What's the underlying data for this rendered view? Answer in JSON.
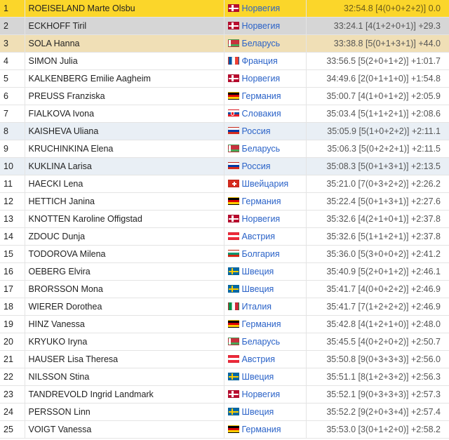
{
  "flag_colors": {
    "nor": "#ba0c2f",
    "blr": "#c8313e",
    "fra": "#0055a4",
    "ger": "#dd0000",
    "svk": "#0b4ea2",
    "rus": "#0039a6",
    "sui": "#d52b1e",
    "aut": "#ed2939",
    "bul": "#00966e",
    "swe": "#006aa7",
    "ita": "#009246"
  },
  "highlight_colors": {
    "gold": "#fbd62a",
    "silver": "#d6d6d6",
    "bronze": "#f0dfb6",
    "hl": "#e9eff5"
  },
  "results": [
    {
      "rank": "1",
      "name": "ROEISELAND Marte Olsbu",
      "flag": "flag-nor",
      "country": "Норвегия",
      "result": "32:54.8 [4(0+0+2+2)] 0.0",
      "style": "gold"
    },
    {
      "rank": "2",
      "name": "ECKHOFF Tiril",
      "flag": "flag-nor",
      "country": "Норвегия",
      "result": "33:24.1 [4(1+2+0+1)] +29.3",
      "style": "silver"
    },
    {
      "rank": "3",
      "name": "SOLA Hanna",
      "flag": "flag-blr",
      "country": "Беларусь",
      "result": "33:38.8 [5(0+1+3+1)] +44.0",
      "style": "bronze"
    },
    {
      "rank": "4",
      "name": "SIMON Julia",
      "flag": "flag-fra",
      "country": "Франция",
      "result": "33:56.5 [5(2+0+1+2)] +1:01.7",
      "style": ""
    },
    {
      "rank": "5",
      "name": "KALKENBERG Emilie Aagheim",
      "flag": "flag-nor",
      "country": "Норвегия",
      "result": "34:49.6 [2(0+1+1+0)] +1:54.8",
      "style": ""
    },
    {
      "rank": "6",
      "name": "PREUSS Franziska",
      "flag": "flag-ger",
      "country": "Германия",
      "result": "35:00.7 [4(1+0+1+2)] +2:05.9",
      "style": ""
    },
    {
      "rank": "7",
      "name": "FIALKOVA Ivona",
      "flag": "flag-svk",
      "country": "Словакия",
      "result": "35:03.4 [5(1+1+2+1)] +2:08.6",
      "style": ""
    },
    {
      "rank": "8",
      "name": "KAISHEVA Uliana",
      "flag": "flag-rus",
      "country": "Россия",
      "result": "35:05.9 [5(1+0+2+2)] +2:11.1",
      "style": "hl"
    },
    {
      "rank": "9",
      "name": "KRUCHINKINA Elena",
      "flag": "flag-blr",
      "country": "Беларусь",
      "result": "35:06.3 [5(0+2+2+1)] +2:11.5",
      "style": ""
    },
    {
      "rank": "10",
      "name": "KUKLINA Larisa",
      "flag": "flag-rus",
      "country": "Россия",
      "result": "35:08.3 [5(0+1+3+1)] +2:13.5",
      "style": "hl"
    },
    {
      "rank": "11",
      "name": "HAECKI Lena",
      "flag": "flag-sui",
      "country": "Швейцария",
      "result": "35:21.0 [7(0+3+2+2)] +2:26.2",
      "style": ""
    },
    {
      "rank": "12",
      "name": "HETTICH Janina",
      "flag": "flag-ger",
      "country": "Германия",
      "result": "35:22.4 [5(0+1+3+1)] +2:27.6",
      "style": ""
    },
    {
      "rank": "13",
      "name": "KNOTTEN Karoline Offigstad",
      "flag": "flag-nor",
      "country": "Норвегия",
      "result": "35:32.6 [4(2+1+0+1)] +2:37.8",
      "style": ""
    },
    {
      "rank": "14",
      "name": "ZDOUC Dunja",
      "flag": "flag-aut",
      "country": "Австрия",
      "result": "35:32.6 [5(1+1+2+1)] +2:37.8",
      "style": ""
    },
    {
      "rank": "15",
      "name": "TODOROVA Milena",
      "flag": "flag-bul",
      "country": "Болгария",
      "result": "35:36.0 [5(3+0+0+2)] +2:41.2",
      "style": ""
    },
    {
      "rank": "16",
      "name": "OEBERG Elvira",
      "flag": "flag-swe",
      "country": "Швеция",
      "result": "35:40.9 [5(2+0+1+2)] +2:46.1",
      "style": ""
    },
    {
      "rank": "17",
      "name": "BRORSSON Mona",
      "flag": "flag-swe",
      "country": "Швеция",
      "result": "35:41.7 [4(0+0+2+2)] +2:46.9",
      "style": ""
    },
    {
      "rank": "18",
      "name": "WIERER Dorothea",
      "flag": "flag-ita",
      "country": "Италия",
      "result": "35:41.7 [7(1+2+2+2)] +2:46.9",
      "style": ""
    },
    {
      "rank": "19",
      "name": "HINZ Vanessa",
      "flag": "flag-ger",
      "country": "Германия",
      "result": "35:42.8 [4(1+2+1+0)] +2:48.0",
      "style": ""
    },
    {
      "rank": "20",
      "name": "KRYUKO Iryna",
      "flag": "flag-blr",
      "country": "Беларусь",
      "result": "35:45.5 [4(0+2+0+2)] +2:50.7",
      "style": ""
    },
    {
      "rank": "21",
      "name": "HAUSER Lisa Theresa",
      "flag": "flag-aut",
      "country": "Австрия",
      "result": "35:50.8 [9(0+3+3+3)] +2:56.0",
      "style": ""
    },
    {
      "rank": "22",
      "name": "NILSSON Stina",
      "flag": "flag-swe",
      "country": "Швеция",
      "result": "35:51.1 [8(1+2+3+2)] +2:56.3",
      "style": ""
    },
    {
      "rank": "23",
      "name": "TANDREVOLD Ingrid Landmark",
      "flag": "flag-nor",
      "country": "Норвегия",
      "result": "35:52.1 [9(0+3+3+3)] +2:57.3",
      "style": ""
    },
    {
      "rank": "24",
      "name": "PERSSON Linn",
      "flag": "flag-swe",
      "country": "Швеция",
      "result": "35:52.2 [9(2+0+3+4)] +2:57.4",
      "style": ""
    },
    {
      "rank": "25",
      "name": "VOIGT Vanessa",
      "flag": "flag-ger",
      "country": "Германия",
      "result": "35:53.0 [3(0+1+2+0)] +2:58.2",
      "style": ""
    }
  ]
}
